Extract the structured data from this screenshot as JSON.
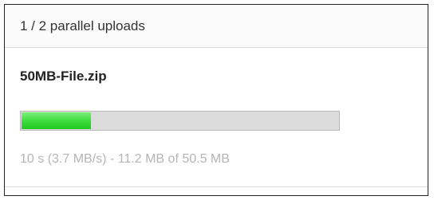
{
  "header": {
    "title": "1 / 2 parallel uploads"
  },
  "upload": {
    "file_name": "50MB-File.zip",
    "progress_fraction": 0.22,
    "status": "10 s (3.7 MB/s) - 11.2 MB of 50.5 MB",
    "progress_color": "#33d633",
    "track_color": "#dcdcdc",
    "status_color": "#b5b5b5"
  }
}
